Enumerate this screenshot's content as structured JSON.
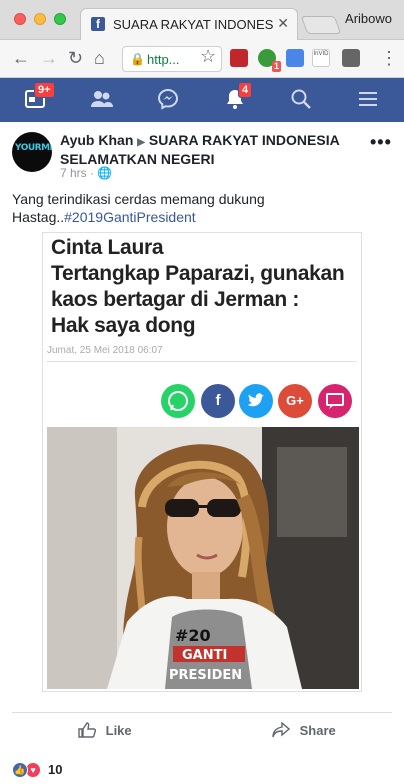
{
  "browser": {
    "tab_title": "SUARA RAKYAT INDONESIA",
    "profile_name": "Aribowo",
    "url": "http...",
    "extension_badge": "1"
  },
  "fb_nav": {
    "items": [
      {
        "icon": "feed-icon",
        "badge": "9+"
      },
      {
        "icon": "friends-icon",
        "badge": ""
      },
      {
        "icon": "messenger-icon",
        "badge": ""
      },
      {
        "icon": "notifications-icon",
        "badge": "4"
      },
      {
        "icon": "search-icon",
        "badge": ""
      },
      {
        "icon": "menu-icon",
        "badge": ""
      }
    ]
  },
  "post": {
    "author": "Ayub Khan",
    "group": "SUARA RAKYAT INDONESIA SELAMATKAN NEGERI",
    "time": "7 hrs",
    "audience_icon": "globe-icon",
    "text_line1": "Yang terindikasi cerdas memang dukung",
    "text_prefix": "Hastag..",
    "hashtag": "#2019GantiPresident",
    "avatar_text": "YOURMEWAN"
  },
  "article": {
    "headline_l1": "Cinta Laura",
    "headline_l2": "Tertangkap Paparazi, gunakan",
    "headline_l3": "kaos bertagar di Jerman :",
    "headline_l4": "Hak saya dong",
    "date": "Jumat, 25 Mei 2018 06:07",
    "share_buttons": [
      {
        "name": "whatsapp",
        "glyph": "✆",
        "color": "#25d366"
      },
      {
        "name": "facebook",
        "glyph": "f",
        "color": "#3b5998"
      },
      {
        "name": "twitter",
        "glyph": "🐦",
        "color": "#1da1f2"
      },
      {
        "name": "google-plus",
        "glyph": "G+",
        "color": "#dd4b39"
      },
      {
        "name": "comment",
        "glyph": "▭",
        "color": "#d6246e"
      }
    ],
    "shirt_text_1": "#20",
    "shirt_text_2": "GANTI",
    "shirt_text_3": "PRESIDEN"
  },
  "actions": {
    "like_label": "Like",
    "share_label": "Share",
    "reaction_count": "10"
  },
  "colors": {
    "fb_blue": "#3b5998",
    "link": "#365899",
    "badge_red": "#fa3e3e"
  }
}
